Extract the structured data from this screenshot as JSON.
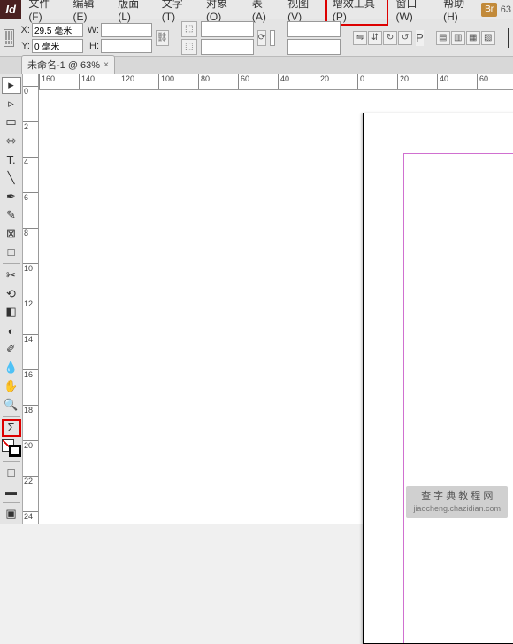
{
  "app": {
    "logo": "Id"
  },
  "menu": {
    "items": [
      "文件(F)",
      "编辑(E)",
      "版面(L)",
      "文字(T)",
      "对象(O)",
      "表(A)",
      "视图(V)",
      "增效工具(P)",
      "窗口(W)",
      "帮助(H)"
    ],
    "highlighted_index": 7,
    "br_badge": "Br",
    "extra": "63"
  },
  "ctrl": {
    "x_label": "X:",
    "x_value": "29.5 毫米",
    "y_label": "Y:",
    "y_value": "0 毫米",
    "w_label": "W:",
    "w_value": "",
    "h_label": "H:",
    "h_value": ""
  },
  "tab": {
    "title": "未命名-1 @ 63%",
    "close": "×"
  },
  "ruler_h": [
    "160",
    "140",
    "120",
    "100",
    "80",
    "60",
    "40",
    "20",
    "0",
    "20",
    "40",
    "60"
  ],
  "ruler_v": [
    "0",
    "2",
    "4",
    "6",
    "8",
    "10",
    "12",
    "14",
    "16",
    "18",
    "20",
    "22",
    "24"
  ],
  "tools": [
    {
      "n": "selection-tool",
      "g": "▸",
      "active": true
    },
    {
      "n": "direct-select-tool",
      "g": "▹"
    },
    {
      "n": "page-tool",
      "g": "▭"
    },
    {
      "n": "gap-tool",
      "g": "⇿"
    },
    {
      "n": "type-tool",
      "g": "T."
    },
    {
      "n": "line-tool",
      "g": "╲"
    },
    {
      "n": "pen-tool",
      "g": "✒"
    },
    {
      "n": "pencil-tool",
      "g": "✎"
    },
    {
      "n": "rectangle-frame-tool",
      "g": "⊠"
    },
    {
      "n": "rectangle-tool",
      "g": "□"
    },
    {
      "n": "sep"
    },
    {
      "n": "scissors-tool",
      "g": "✂"
    },
    {
      "n": "transform-tool",
      "g": "⟲"
    },
    {
      "n": "gradient-swatch-tool",
      "g": "◧"
    },
    {
      "n": "gradient-feather-tool",
      "g": "◐"
    },
    {
      "n": "note-tool",
      "g": "✐"
    },
    {
      "n": "eyedropper-tool",
      "g": "💧"
    },
    {
      "n": "hand-tool",
      "g": "✋"
    },
    {
      "n": "zoom-tool",
      "g": "🔍"
    },
    {
      "n": "sep"
    },
    {
      "n": "sigma-tool",
      "g": "Σ",
      "red": true
    },
    {
      "n": "color-swap",
      "g": ""
    },
    {
      "n": "sep"
    },
    {
      "n": "format-container",
      "g": "□"
    },
    {
      "n": "apply-color",
      "g": "▬"
    },
    {
      "n": "sep"
    },
    {
      "n": "view-mode",
      "g": "▣"
    }
  ],
  "watermark": {
    "line1": "查 字 典  教 程 网",
    "line2": "jiaocheng.chazidian.com"
  }
}
